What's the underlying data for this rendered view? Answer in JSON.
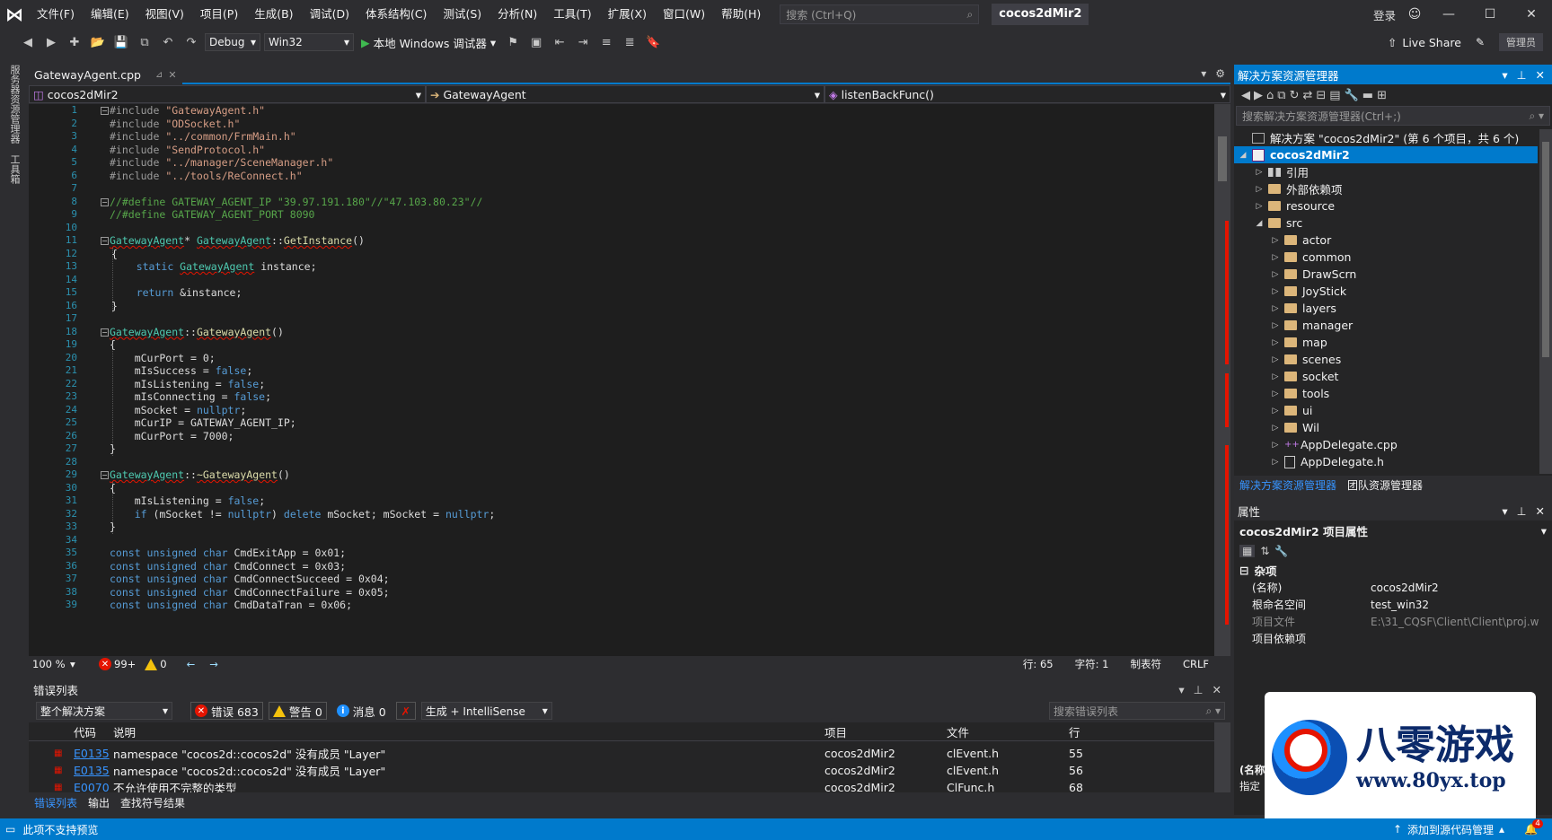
{
  "menu": {
    "items": [
      "文件(F)",
      "编辑(E)",
      "视图(V)",
      "项目(P)",
      "生成(B)",
      "调试(D)",
      "体系结构(C)",
      "测试(S)",
      "分析(N)",
      "工具(T)",
      "扩展(X)",
      "窗口(W)",
      "帮助(H)"
    ],
    "search_placeholder": "搜索 (Ctrl+Q)",
    "app_title": "cocos2dMir2",
    "login": "登录"
  },
  "toolbar": {
    "config": "Debug",
    "platform": "Win32",
    "run_label": "本地 Windows 调试器",
    "live_share": "Live Share",
    "admin": "管理员"
  },
  "left_strip": {
    "server_explorer": "服务器资源管理器",
    "toolbox": "工具箱"
  },
  "editor": {
    "tab_name": "GatewayAgent.cpp",
    "nav_project": "cocos2dMir2",
    "nav_class": "GatewayAgent",
    "nav_member": "listenBackFunc()",
    "zoom": "100 %",
    "errors_badge": "99+",
    "warnings_badge": "0",
    "line_info": "行: 65",
    "char_info": "字符: 1",
    "tab_mode": "制表符",
    "line_ending": "CRLF",
    "line_numbers": [
      "1",
      "2",
      "3",
      "4",
      "5",
      "6",
      "7",
      "8",
      "9",
      "10",
      "11",
      "12",
      "13",
      "14",
      "15",
      "16",
      "17",
      "18",
      "19",
      "20",
      "21",
      "22",
      "23",
      "24",
      "25",
      "26",
      "27",
      "28",
      "29",
      "30",
      "31",
      "32",
      "33",
      "34",
      "35",
      "36",
      "37",
      "38",
      "39"
    ],
    "code": [
      {
        "parts": [
          [
            "pp",
            "#include "
          ],
          [
            "st",
            "\"GatewayAgent.h\""
          ]
        ]
      },
      {
        "parts": [
          [
            "pp",
            "#include "
          ],
          [
            "st",
            "\"ODSocket.h\""
          ]
        ]
      },
      {
        "parts": [
          [
            "pp",
            "#include "
          ],
          [
            "st",
            "\"../common/FrmMain.h\""
          ]
        ]
      },
      {
        "parts": [
          [
            "pp",
            "#include "
          ],
          [
            "st",
            "\"SendProtocol.h\""
          ]
        ]
      },
      {
        "parts": [
          [
            "pp",
            "#include "
          ],
          [
            "st",
            "\"../manager/SceneManager.h\""
          ]
        ]
      },
      {
        "parts": [
          [
            "pp",
            "#include "
          ],
          [
            "st",
            "\"../tools/ReConnect.h\""
          ]
        ]
      },
      {
        "parts": []
      },
      {
        "parts": [
          [
            "cm",
            "//#define GATEWAY_AGENT_IP \"39.97.191.180\"//\"47.103.80.23\"//"
          ]
        ]
      },
      {
        "parts": [
          [
            "cm",
            "//#define GATEWAY_AGENT_PORT 8090"
          ]
        ]
      },
      {
        "parts": []
      },
      {
        "parts": [
          [
            "ty",
            "GatewayAgent"
          ],
          [
            "vr",
            "* "
          ],
          [
            "ty",
            "GatewayAgent"
          ],
          [
            "vr",
            "::"
          ],
          [
            "fn",
            "GetInstance"
          ],
          [
            "vr",
            "()"
          ]
        ]
      },
      {
        "parts": [
          [
            "vr",
            "{"
          ]
        ]
      },
      {
        "parts": [
          [
            "vr",
            "    "
          ],
          [
            "kw",
            "static "
          ],
          [
            "ty",
            "GatewayAgent"
          ],
          [
            "vr",
            " instance;"
          ]
        ]
      },
      {
        "parts": []
      },
      {
        "parts": [
          [
            "vr",
            "    "
          ],
          [
            "kw",
            "return "
          ],
          [
            "vr",
            "&instance;"
          ]
        ]
      },
      {
        "parts": [
          [
            "vr",
            "}"
          ]
        ]
      },
      {
        "parts": []
      },
      {
        "parts": [
          [
            "ty",
            "GatewayAgent"
          ],
          [
            "vr",
            "::"
          ],
          [
            "fn",
            "GatewayAgent"
          ],
          [
            "vr",
            "()"
          ]
        ]
      },
      {
        "parts": [
          [
            "vr",
            "{"
          ]
        ]
      },
      {
        "parts": [
          [
            "vr",
            "    mCurPort = 0;"
          ]
        ]
      },
      {
        "parts": [
          [
            "vr",
            "    mIsSuccess = "
          ],
          [
            "kw",
            "false"
          ],
          [
            "vr",
            ";"
          ]
        ]
      },
      {
        "parts": [
          [
            "vr",
            "    mIsListening = "
          ],
          [
            "kw",
            "false"
          ],
          [
            "vr",
            ";"
          ]
        ]
      },
      {
        "parts": [
          [
            "vr",
            "    mIsConnecting = "
          ],
          [
            "kw",
            "false"
          ],
          [
            "vr",
            ";"
          ]
        ]
      },
      {
        "parts": [
          [
            "vr",
            "    mSocket = "
          ],
          [
            "kw",
            "nullptr"
          ],
          [
            "vr",
            ";"
          ]
        ]
      },
      {
        "parts": [
          [
            "vr",
            "    mCurIP = GATEWAY_AGENT_IP;"
          ]
        ]
      },
      {
        "parts": [
          [
            "vr",
            "    mCurPort = 7000;"
          ]
        ]
      },
      {
        "parts": [
          [
            "vr",
            "}"
          ]
        ]
      },
      {
        "parts": []
      },
      {
        "parts": [
          [
            "ty",
            "GatewayAgent"
          ],
          [
            "vr",
            "::"
          ],
          [
            "fn",
            "~GatewayAgent"
          ],
          [
            "vr",
            "()"
          ]
        ]
      },
      {
        "parts": [
          [
            "vr",
            "{"
          ]
        ]
      },
      {
        "parts": [
          [
            "vr",
            "    mIsListening = "
          ],
          [
            "kw",
            "false"
          ],
          [
            "vr",
            ";"
          ]
        ]
      },
      {
        "parts": [
          [
            "vr",
            "    "
          ],
          [
            "kw",
            "if "
          ],
          [
            "vr",
            "(mSocket != "
          ],
          [
            "kw",
            "nullptr"
          ],
          [
            "vr",
            ") "
          ],
          [
            "kw",
            "delete "
          ],
          [
            "vr",
            "mSocket; mSocket = "
          ],
          [
            "kw",
            "nullptr"
          ],
          [
            "vr",
            ";"
          ]
        ]
      },
      {
        "parts": [
          [
            "vr",
            "}"
          ]
        ]
      },
      {
        "parts": []
      },
      {
        "parts": [
          [
            "kw",
            "const unsigned char "
          ],
          [
            "vr",
            "CmdExitApp = 0x01;"
          ]
        ]
      },
      {
        "parts": [
          [
            "kw",
            "const unsigned char "
          ],
          [
            "vr",
            "CmdConnect = 0x03;"
          ]
        ]
      },
      {
        "parts": [
          [
            "kw",
            "const unsigned char "
          ],
          [
            "vr",
            "CmdConnectSucceed = 0x04;"
          ]
        ]
      },
      {
        "parts": [
          [
            "kw",
            "const unsigned char "
          ],
          [
            "vr",
            "CmdConnectFailure = 0x05;"
          ]
        ]
      },
      {
        "parts": [
          [
            "kw",
            "const unsigned char "
          ],
          [
            "vr",
            "CmdDataTran = 0x06;"
          ]
        ]
      }
    ]
  },
  "error_list": {
    "title": "错误列表",
    "scope": "整个解决方案",
    "errors_label": "错误 683",
    "warnings_label": "警告 0",
    "messages_label": "消息 0",
    "build_filter": "生成 + IntelliSense",
    "search_placeholder": "搜索错误列表",
    "columns": [
      "代码",
      "说明",
      "项目",
      "文件",
      "行"
    ],
    "rows": [
      {
        "code": "E0135",
        "desc": "namespace \"cocos2d::cocos2d\" 没有成员 \"Layer\"",
        "project": "cocos2dMir2",
        "file": "clEvent.h",
        "line": "55"
      },
      {
        "code": "E0135",
        "desc": "namespace \"cocos2d::cocos2d\" 没有成员 \"Layer\"",
        "project": "cocos2dMir2",
        "file": "clEvent.h",
        "line": "56"
      },
      {
        "code": "E0070",
        "desc": "不允许使用不完整的类型",
        "project": "cocos2dMir2",
        "file": "ClFunc.h",
        "line": "68"
      }
    ],
    "tabs": [
      "错误列表",
      "输出",
      "查找符号结果"
    ]
  },
  "solution_explorer": {
    "title": "解决方案资源管理器",
    "search_placeholder": "搜索解决方案资源管理器(Ctrl+;)",
    "solution_label": "解决方案 \"cocos2dMir2\" (第 6 个项目，共 6 个)",
    "project_label": "cocos2dMir2",
    "top_items": [
      "引用",
      "外部依赖项",
      "resource",
      "src"
    ],
    "src_children": [
      "actor",
      "common",
      "DrawScrn",
      "JoyStick",
      "layers",
      "manager",
      "map",
      "scenes",
      "socket",
      "tools",
      "ui",
      "Wil"
    ],
    "files": [
      "AppDelegate.cpp",
      "AppDelegate.h"
    ],
    "tabs": [
      "解决方案资源管理器",
      "团队资源管理器"
    ]
  },
  "properties": {
    "title": "属性",
    "selection": "cocos2dMir2 项目属性",
    "category": "杂项",
    "rows": [
      {
        "key": "(名称)",
        "value": "cocos2dMir2",
        "dim": false
      },
      {
        "key": "根命名空间",
        "value": "test_win32",
        "dim": false
      },
      {
        "key": "项目文件",
        "value": "E:\\31_CQSF\\Client\\Client\\proj.w",
        "dim": true
      },
      {
        "key": "项目依赖项",
        "value": "",
        "dim": false
      }
    ],
    "desc_partial": "(名称",
    "desc_partial2": "指定"
  },
  "status": {
    "left": "此项不支持预览",
    "source_control": "添加到源代码管理",
    "notify_count": "4"
  },
  "watermark": {
    "brand": "八零游戏",
    "url": "www.80yx.top"
  }
}
